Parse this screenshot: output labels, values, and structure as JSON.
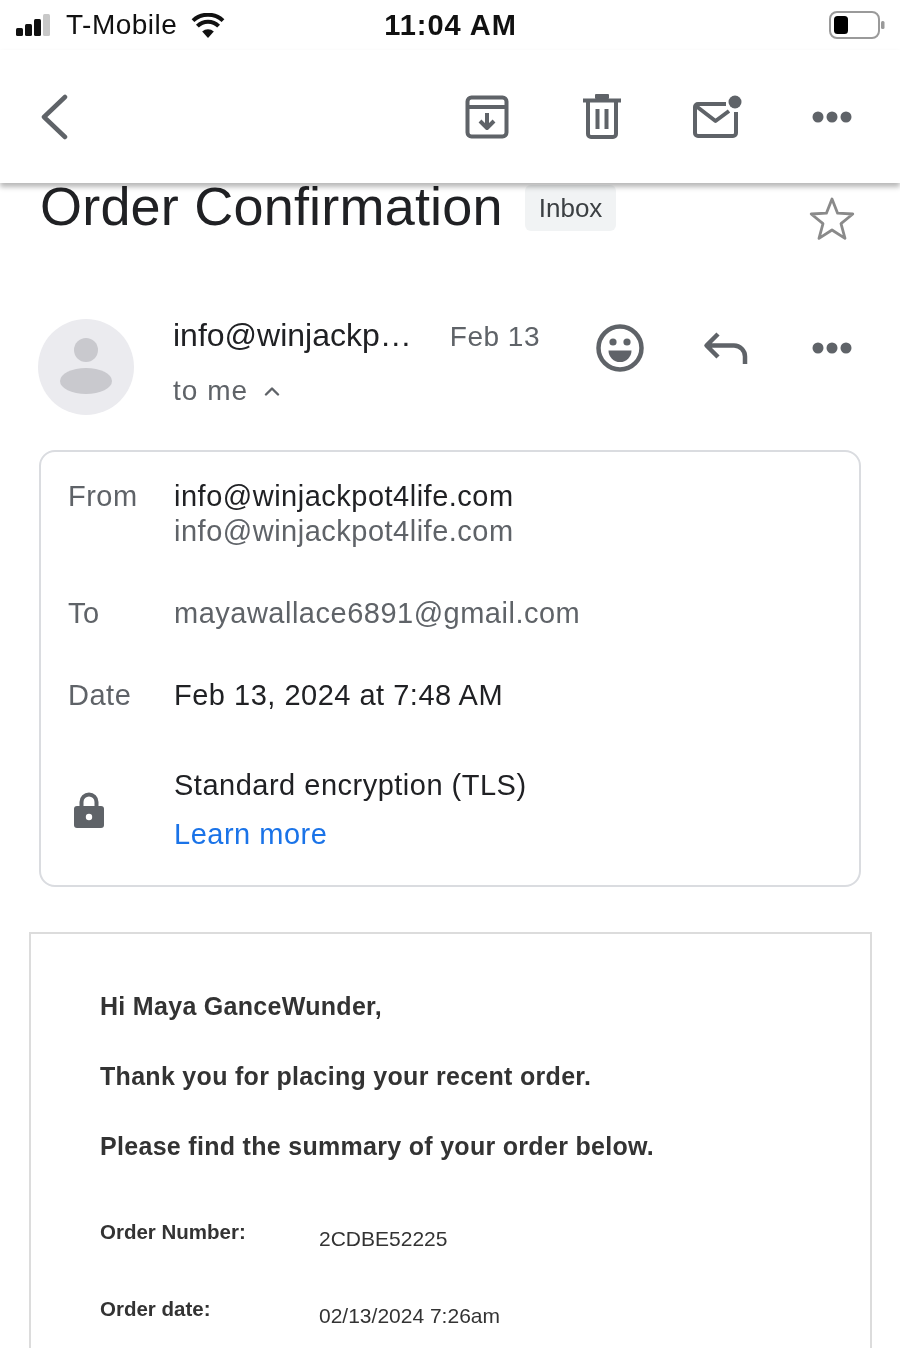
{
  "status_bar": {
    "carrier": "T-Mobile",
    "time": "11:04 AM"
  },
  "message": {
    "subject": "Order Confirmation",
    "label": "Inbox",
    "starred": false,
    "sender": "info@winjackp…",
    "date": "Feb 13",
    "recipients": "to me",
    "details_expanded": true
  },
  "details": {
    "rows": [
      {
        "kind": "sender",
        "label": "From",
        "name": "info@winjackpot4life.com",
        "address": "info@winjackpot4life.com"
      },
      {
        "kind": "recipient",
        "label": "To",
        "address": "mayawallace6891@gmail.com"
      },
      {
        "kind": "date",
        "label": "Date",
        "value": "Feb 13, 2024 at 7:48 AM"
      }
    ],
    "security": {
      "text": "Standard encryption (TLS)",
      "link": "Learn more"
    }
  },
  "body": {
    "paragraphs": [
      "Hi Maya GanceWunder,",
      "Thank you for placing your recent order.",
      "Please find the summary of your order below."
    ],
    "order_fields": [
      {
        "label": "Order Number:",
        "value": "2CDBE52225"
      },
      {
        "label": "Order date:",
        "value": "02/13/2024 7:26am"
      }
    ]
  }
}
